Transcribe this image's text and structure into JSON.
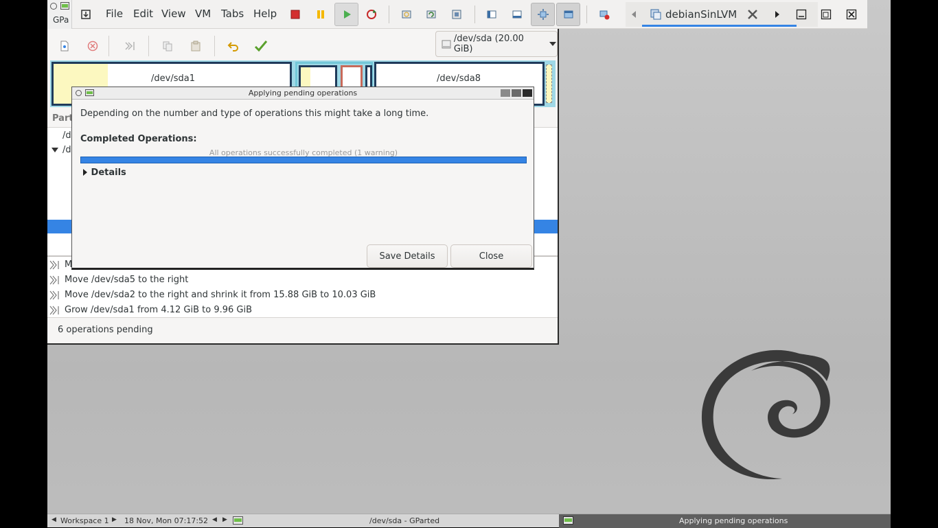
{
  "vm_toolbar": {
    "menu": [
      "File",
      "Edit",
      "View",
      "VM",
      "Tabs",
      "Help"
    ],
    "tab_label": "debianSinLVM"
  },
  "gparted": {
    "title_stub": "GPa",
    "device_selector": "/dev/sda (20.00 GiB)",
    "partition_map": {
      "left_label": "/dev/sda1",
      "right_label": "/dev/sda8"
    },
    "list_header_stub": "Part",
    "list_rows_stub": [
      "/d",
      "/d"
    ],
    "operations": [
      {
        "text": "M"
      },
      {
        "text": "Move /dev/sda5 to the right"
      },
      {
        "text": "Move /dev/sda2 to the right and shrink it from 15.88 GiB to 10.03 GiB"
      },
      {
        "text": "Grow /dev/sda1 from 4.12 GiB to 9.96 GiB"
      }
    ],
    "status": "6 operations pending"
  },
  "dialog": {
    "title": "Applying pending operations",
    "message": "Depending on the number and type of operations this might take a long time.",
    "completed_label": "Completed Operations:",
    "progress_text": "All operations successfully completed (1 warning)",
    "progress_fraction": 1.0,
    "details_label": "Details",
    "save_button": "Save Details",
    "close_button": "Close"
  },
  "panel": {
    "workspace": "Workspace 1",
    "datetime": "18 Nov, Mon 07:17:52",
    "task_center": "/dev/sda - GParted",
    "task_right": "Applying pending operations"
  },
  "colors": {
    "accent": "#3584e4",
    "partmap_bg": "#9fd8e6",
    "partition_border": "#1f3a5a"
  }
}
